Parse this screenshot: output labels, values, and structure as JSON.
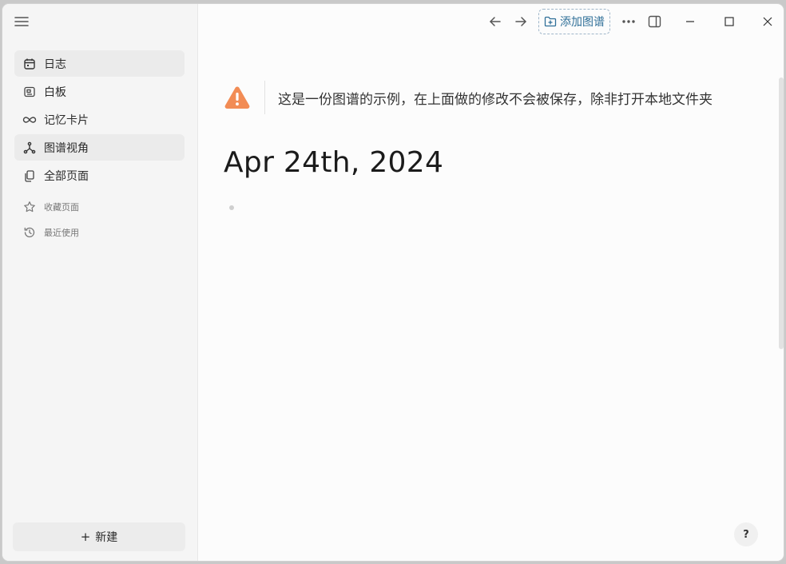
{
  "sidebar": {
    "items": [
      {
        "label": "日志",
        "icon": "calendar-icon",
        "active": true
      },
      {
        "label": "白板",
        "icon": "whiteboard-icon"
      },
      {
        "label": "记忆卡片",
        "icon": "infinity-icon"
      },
      {
        "label": "图谱视角",
        "icon": "graph-icon",
        "active": true
      },
      {
        "label": "全部页面",
        "icon": "pages-icon"
      }
    ],
    "secondary": [
      {
        "label": "收藏页面",
        "icon": "star-icon"
      },
      {
        "label": "最近使用",
        "icon": "history-icon"
      }
    ],
    "new_button": {
      "label": "新建",
      "plus": "+"
    }
  },
  "toolbar": {
    "add_graph_label": "添加图谱"
  },
  "main": {
    "notice_text": "这是一份图谱的示例，在上面做的修改不会被保存，除非打开本地文件夹",
    "page_title": "Apr 24th, 2024",
    "help_label": "?"
  },
  "colors": {
    "accent": "#2f6f98",
    "warning": "#f28c55"
  }
}
